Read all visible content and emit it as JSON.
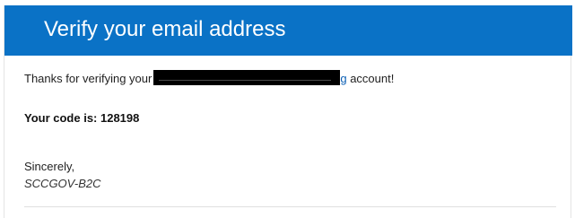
{
  "banner": {
    "title": "Verify your email address"
  },
  "message": {
    "greeting_prefix": "Thanks for verifying your",
    "domain_visible_suffix": "g",
    "greeting_suffix": " account!",
    "code_label": "Your code is: 128198",
    "signoff": "Sincerely,",
    "sender": "SCCGOV-B2C"
  },
  "colors": {
    "banner": "#0a72c6",
    "link": "#0b5fb5"
  }
}
